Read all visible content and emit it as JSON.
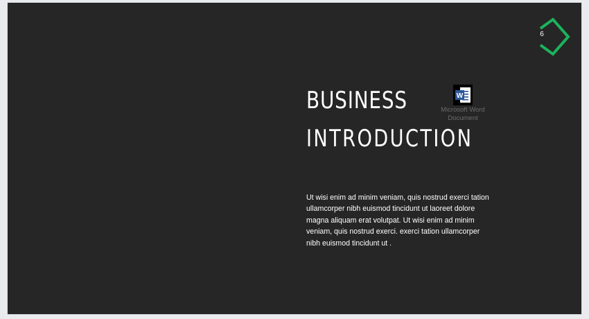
{
  "slide": {
    "number": "6",
    "title_line1": "BUSINESS",
    "title_line2": "INTRODUCTION",
    "body": "Ut wisi enim ad minim veniam, quis nostrud exerci tation ullamcorper nibh euismod tincidunt ut laoreet dolore magna aliquam erat volutpat. Ut wisi enim ad minim veniam, quis nostrud exerci. exerci tation ullamcorper nibh euismod tincidunt ut .",
    "embedded_object": {
      "label": "Microsoft Word Document",
      "icon": "word-document-icon"
    },
    "badge_icon": "diamond-chevron-icon"
  },
  "colors": {
    "page_background": "#e9ebee",
    "slide_background": "#262626",
    "accent_green": "#1bb35c",
    "word_blue": "#2b579a",
    "text": "#ffffff"
  }
}
